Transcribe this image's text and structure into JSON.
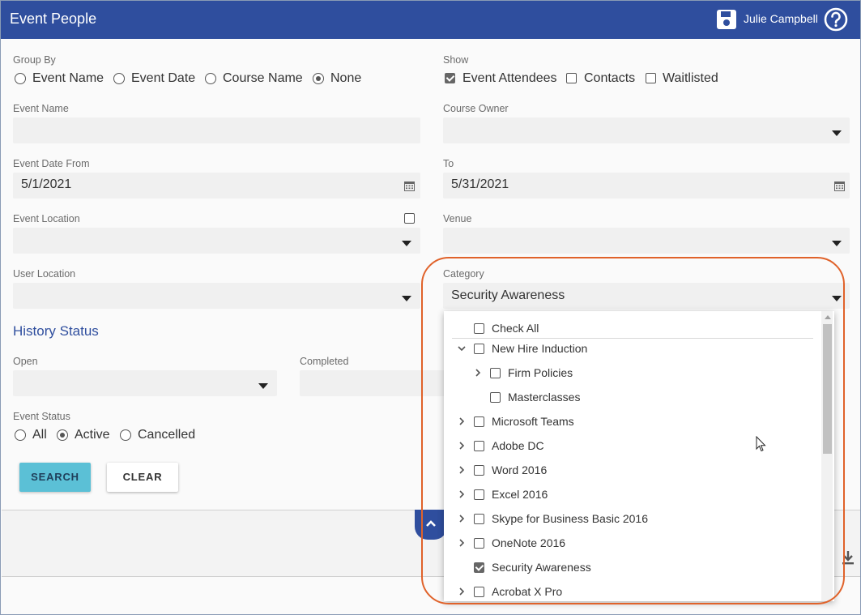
{
  "header": {
    "title": "Event People",
    "user_name": "Julie Campbell"
  },
  "group_by": {
    "label": "Group By",
    "options": [
      "Event Name",
      "Event Date",
      "Course Name",
      "None"
    ],
    "selected": "None"
  },
  "show": {
    "label": "Show",
    "options": [
      {
        "label": "Event Attendees",
        "checked": true
      },
      {
        "label": "Contacts",
        "checked": false
      },
      {
        "label": "Waitlisted",
        "checked": false
      }
    ]
  },
  "event_name": {
    "label": "Event Name",
    "value": ""
  },
  "course_owner": {
    "label": "Course Owner",
    "value": ""
  },
  "event_date_from": {
    "label": "Event Date From",
    "value": "5/1/2021"
  },
  "event_date_to": {
    "label": "To",
    "value": "5/31/2021"
  },
  "event_location": {
    "label": "Event Location",
    "value": ""
  },
  "venue": {
    "label": "Venue",
    "value": ""
  },
  "user_location": {
    "label": "User Location",
    "value": ""
  },
  "category": {
    "label": "Category",
    "value": "Security Awareness",
    "items": [
      {
        "label": "Check All",
        "checked": false,
        "expander": "none",
        "level": 0
      },
      {
        "label": "New Hire Induction",
        "checked": false,
        "expander": "expanded",
        "level": 0
      },
      {
        "label": "Firm Policies",
        "checked": false,
        "expander": "collapsed",
        "level": 1
      },
      {
        "label": "Masterclasses",
        "checked": false,
        "expander": "none",
        "level": 1
      },
      {
        "label": "Microsoft Teams",
        "checked": false,
        "expander": "collapsed",
        "level": 0
      },
      {
        "label": "Adobe DC",
        "checked": false,
        "expander": "collapsed",
        "level": 0
      },
      {
        "label": "Word 2016",
        "checked": false,
        "expander": "collapsed",
        "level": 0
      },
      {
        "label": "Excel 2016",
        "checked": false,
        "expander": "collapsed",
        "level": 0
      },
      {
        "label": "Skype for Business Basic 2016",
        "checked": false,
        "expander": "collapsed",
        "level": 0
      },
      {
        "label": "OneNote 2016",
        "checked": false,
        "expander": "collapsed",
        "level": 0
      },
      {
        "label": "Security Awareness",
        "checked": true,
        "expander": "none",
        "level": 0
      },
      {
        "label": "Acrobat X Pro",
        "checked": false,
        "expander": "collapsed",
        "level": 0
      }
    ]
  },
  "history_status": {
    "title": "History Status",
    "open_label": "Open",
    "completed_label": "Completed"
  },
  "event_status": {
    "label": "Event Status",
    "options": [
      "All",
      "Active",
      "Cancelled"
    ],
    "selected": "Active"
  },
  "buttons": {
    "search": "SEARCH",
    "clear": "CLEAR"
  },
  "colors": {
    "header": "#2f4e9e",
    "search_button": "#5bc0d6",
    "highlight": "#e0622a",
    "section_title": "#2f4e9e"
  }
}
